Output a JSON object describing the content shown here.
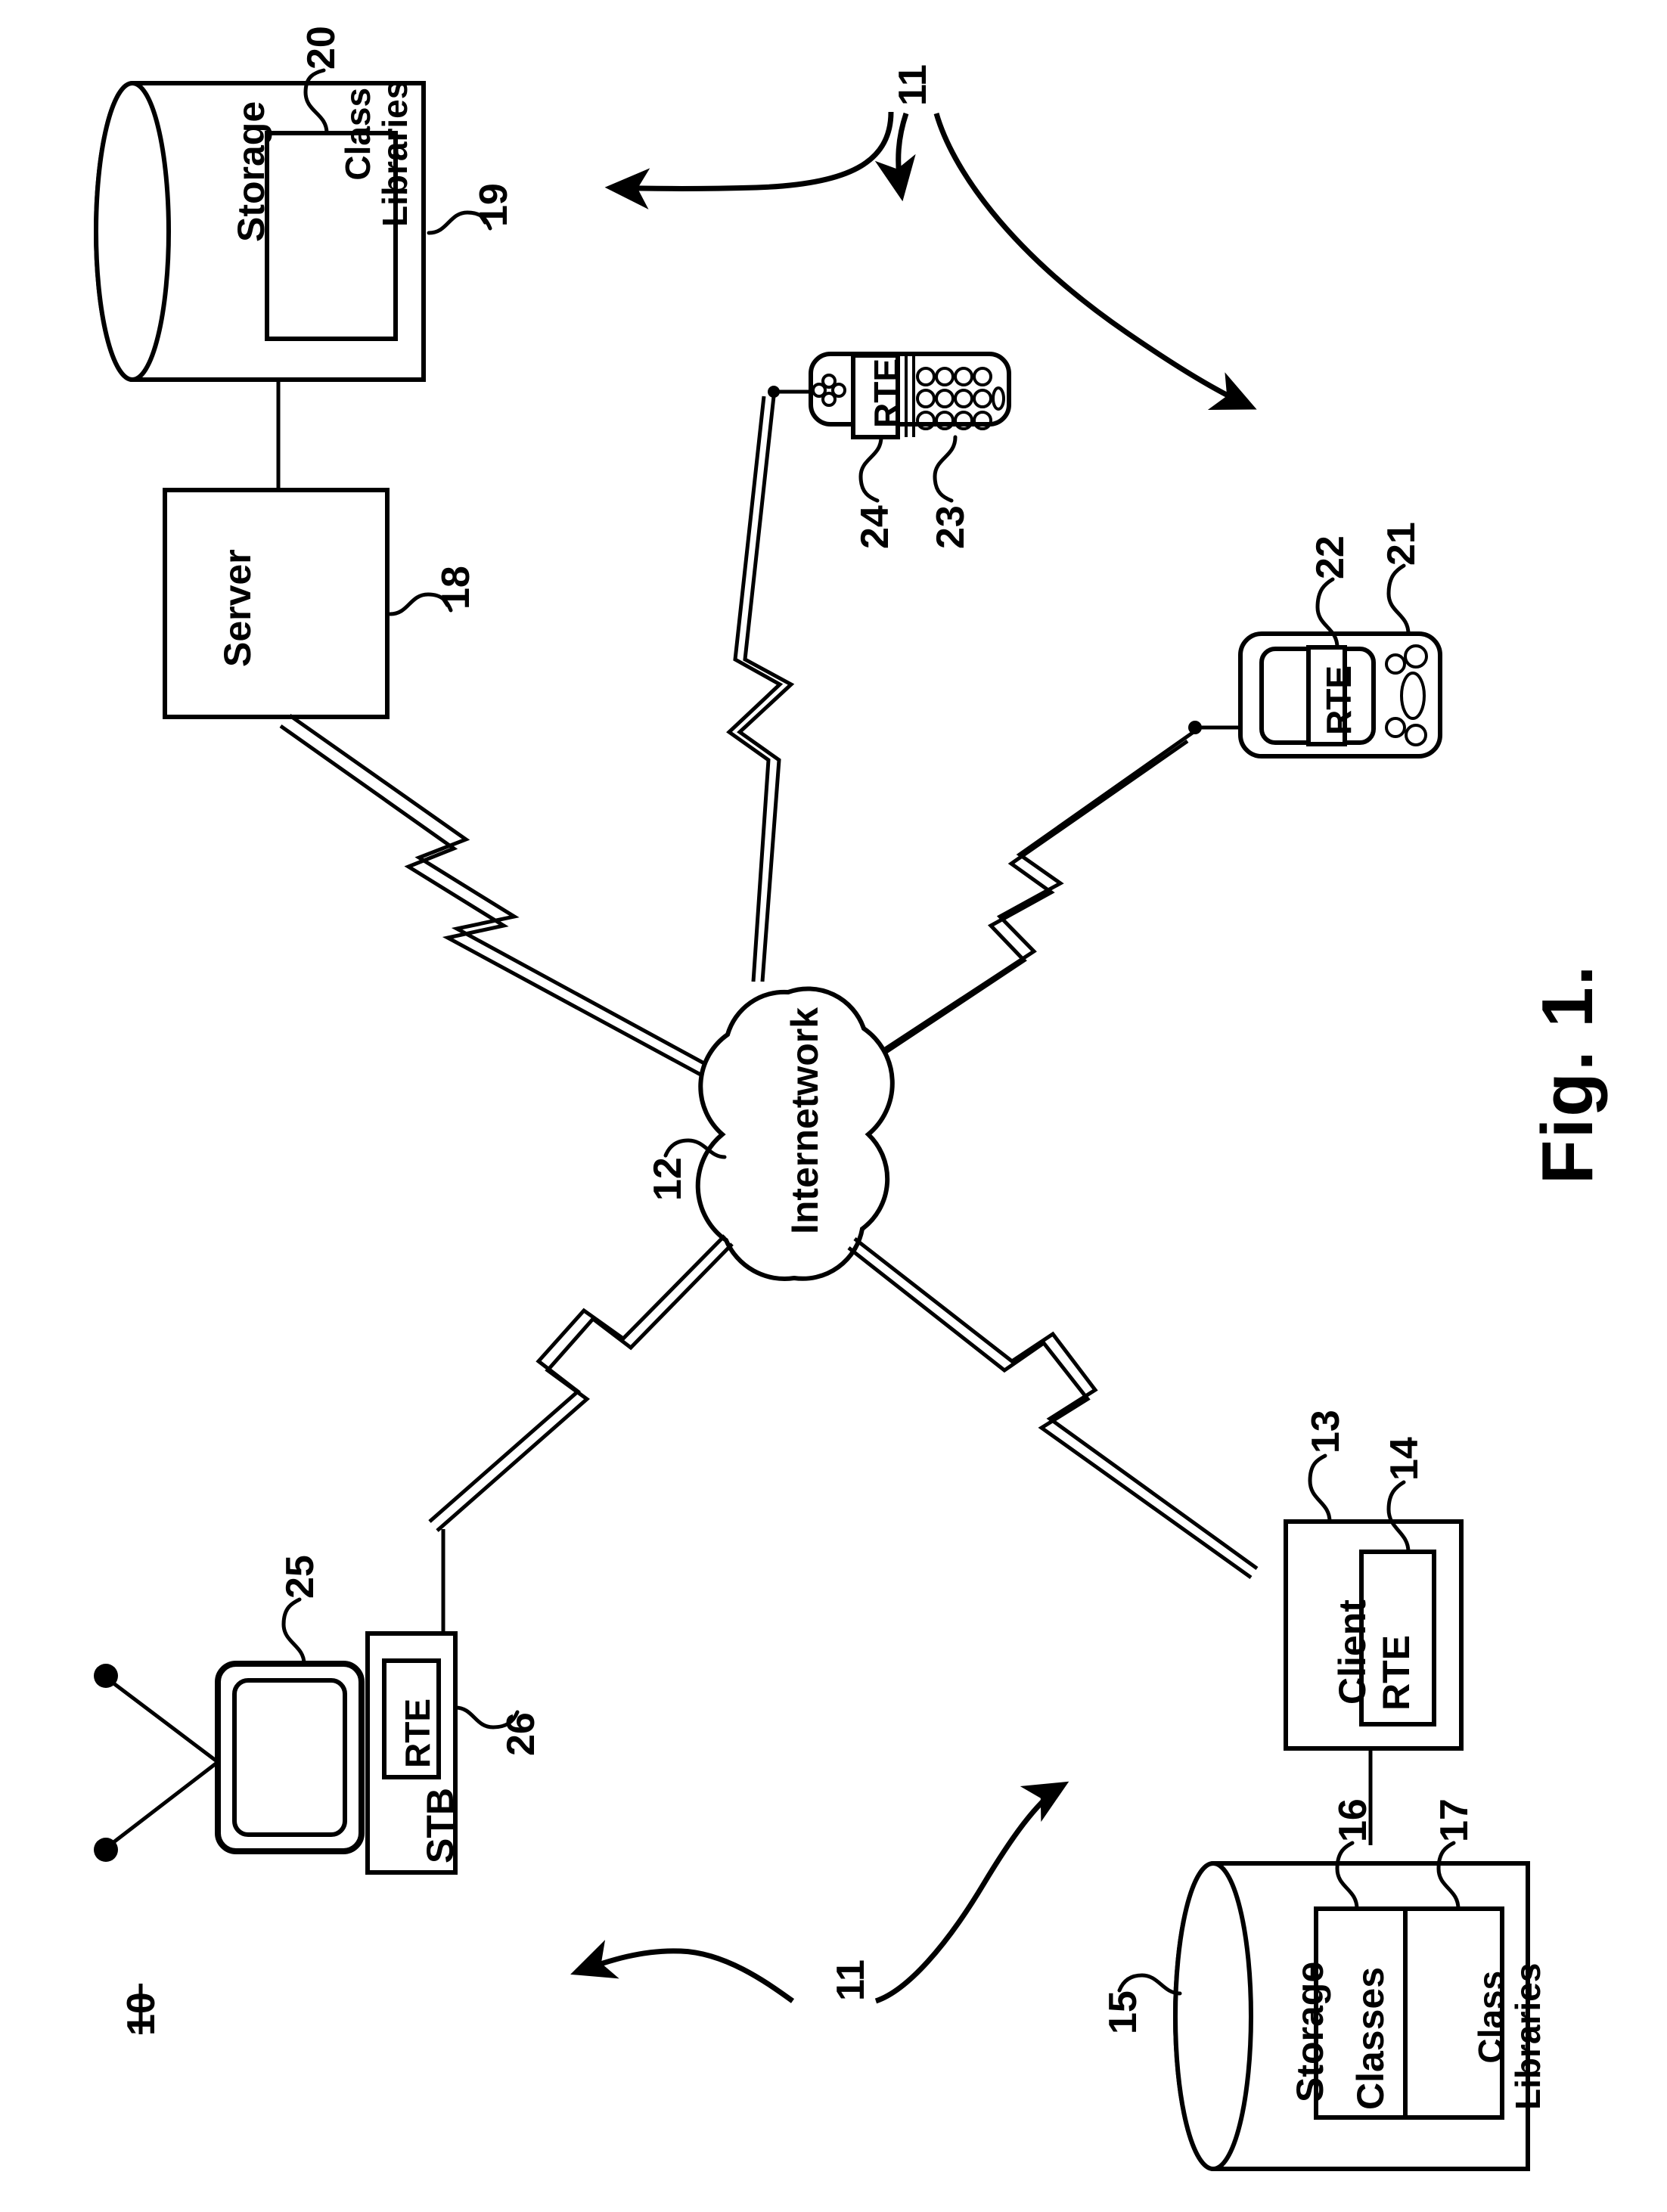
{
  "figure": {
    "title": "Fig. 1.",
    "system_ref": "10",
    "background_color": "#ffffff",
    "line_color": "#000000"
  },
  "nodes": {
    "server_storage": {
      "shape": "cylinder",
      "label": "Storage",
      "ref": "19",
      "inner_boxes": [
        {
          "label": "Class\nLibraries",
          "ref": "20"
        }
      ]
    },
    "server": {
      "shape": "rectangle",
      "label": "Server",
      "ref": "18"
    },
    "mobile_phone": {
      "shape": "handset",
      "ref": "23",
      "screen_label": "RTE",
      "screen_ref": "24",
      "keypad_rows": 3,
      "keypad_cols": 4,
      "nav_dots": 4
    },
    "pda": {
      "shape": "pda",
      "ref": "21",
      "screen_label": "RTE",
      "screen_ref": "22",
      "buttons": 4,
      "has_oval_button": true
    },
    "internetwork": {
      "shape": "cloud",
      "label": "Internetwork",
      "ref": "12"
    },
    "television": {
      "shape": "tv",
      "ref": "25",
      "has_antenna": true
    },
    "set_top_box": {
      "shape": "rectangle",
      "label": "STB",
      "inner_boxes": [
        {
          "label": "RTE",
          "ref": "26"
        }
      ]
    },
    "client": {
      "shape": "rectangle",
      "label": "Client",
      "ref": "13",
      "inner_boxes": [
        {
          "label": "RTE",
          "ref": "14"
        }
      ]
    },
    "client_storage": {
      "shape": "cylinder",
      "label": "Storage",
      "ref": "15",
      "inner_boxes": [
        {
          "label": "Classes",
          "ref": "16"
        },
        {
          "label": "Class\nLibraries",
          "ref": "17"
        }
      ]
    }
  },
  "annotations": {
    "link_ref_top": "11",
    "link_ref_bottom": "11"
  },
  "ref_numbers": {
    "n10": "10",
    "n11a": "11",
    "n11b": "11",
    "n12": "12",
    "n13": "13",
    "n14": "14",
    "n15": "15",
    "n16": "16",
    "n17": "17",
    "n18": "18",
    "n19": "19",
    "n20": "20",
    "n21": "21",
    "n22": "22",
    "n23": "23",
    "n24": "24",
    "n25": "25",
    "n26": "26"
  },
  "text_labels": {
    "storage_top": "Storage",
    "class_libraries_top": "Class\nLibraries",
    "server": "Server",
    "rte_phone": "RTE",
    "rte_pda": "RTE",
    "internetwork": "Internetwork",
    "stb": "STB",
    "rte_stb": "RTE",
    "client": "Client",
    "rte_client": "RTE",
    "storage_bottom": "Storage",
    "classes": "Classes",
    "class_libraries_bottom": "Class\nLibraries",
    "fig_caption": "Fig. 1.",
    "system_number": "10"
  }
}
